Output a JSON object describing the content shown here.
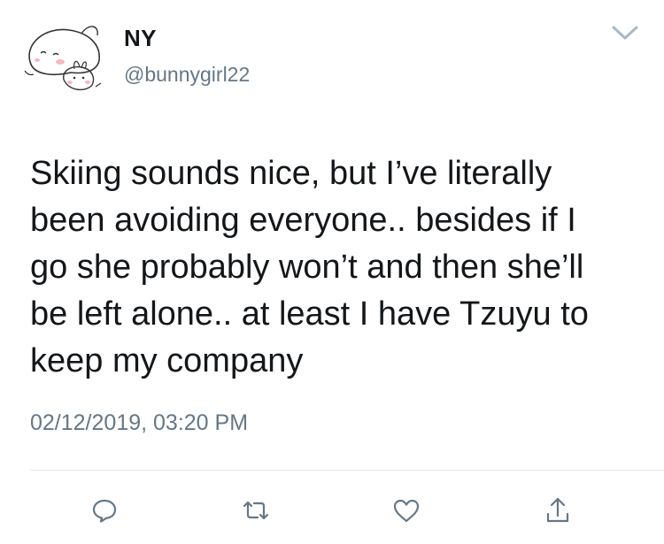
{
  "user": {
    "display_name": "NY",
    "handle": "@bunnygirl22",
    "avatar_icon": "bunny-avatar-icon"
  },
  "tweet": {
    "text": "Skiing sounds nice, but I’ve literally\nbeen avoiding everyone.. besides if I\ngo she probably won’t and then she’ll\nbe left alone.. at least I have Tzuyu to\nkeep my company",
    "timestamp": "02/12/2019, 03:20 PM"
  },
  "actions": [
    {
      "icon": "reply-icon"
    },
    {
      "icon": "retweet-icon"
    },
    {
      "icon": "like-icon"
    },
    {
      "icon": "share-icon"
    }
  ],
  "colors": {
    "text": "#14171a",
    "secondary": "#657786",
    "icon": "#657786",
    "divider": "#e1e8ed"
  }
}
